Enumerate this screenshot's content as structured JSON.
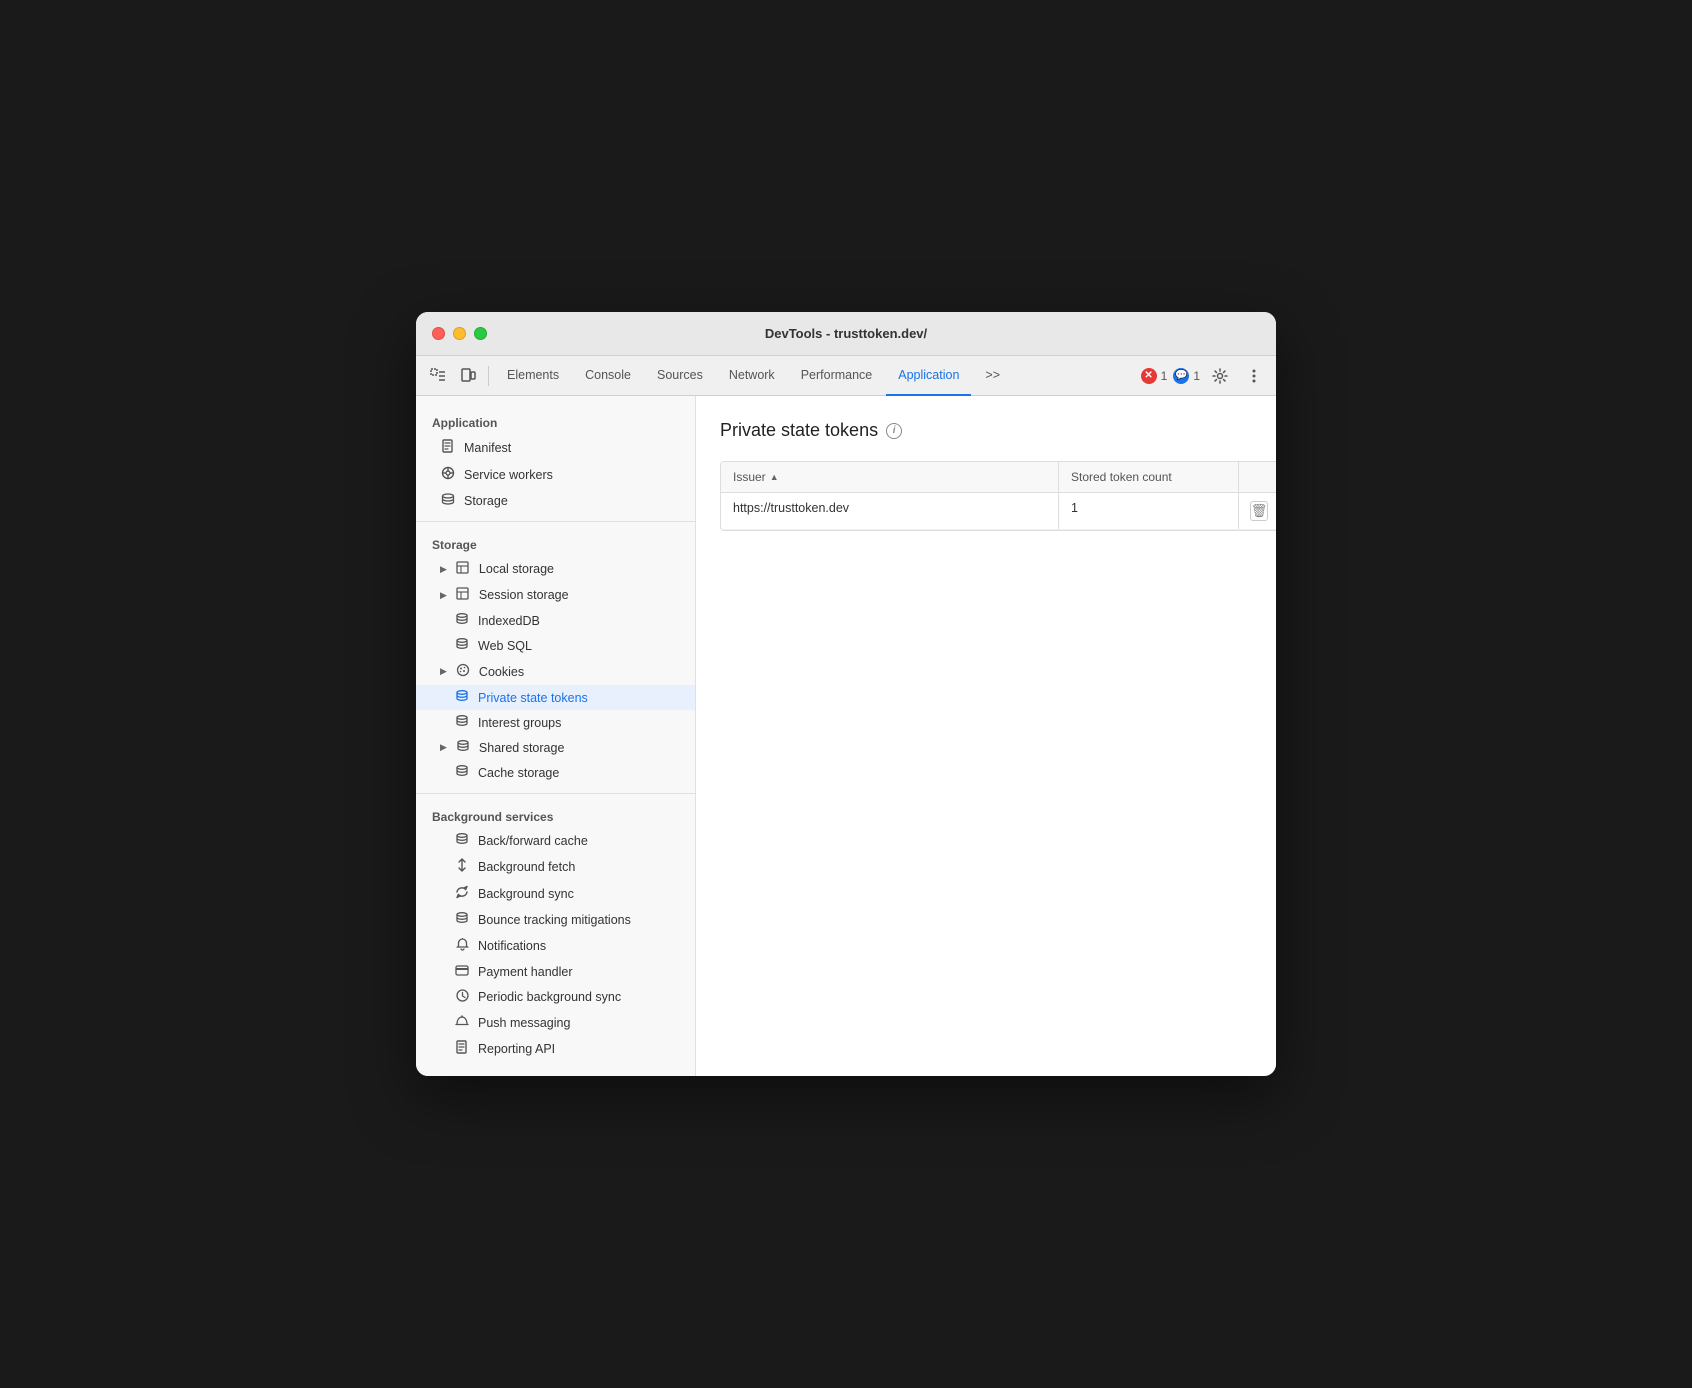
{
  "window": {
    "title": "DevTools - trusttoken.dev/"
  },
  "toolbar": {
    "tabs": [
      {
        "id": "elements",
        "label": "Elements",
        "active": false
      },
      {
        "id": "console",
        "label": "Console",
        "active": false
      },
      {
        "id": "sources",
        "label": "Sources",
        "active": false
      },
      {
        "id": "network",
        "label": "Network",
        "active": false
      },
      {
        "id": "performance",
        "label": "Performance",
        "active": false
      },
      {
        "id": "application",
        "label": "Application",
        "active": true
      }
    ],
    "more_label": ">>",
    "error_count": "1",
    "info_count": "1"
  },
  "sidebar": {
    "application_section": "Application",
    "application_items": [
      {
        "id": "manifest",
        "label": "Manifest",
        "icon": "📄",
        "has_arrow": false
      },
      {
        "id": "service-workers",
        "label": "Service workers",
        "icon": "⚙",
        "has_arrow": false
      },
      {
        "id": "storage",
        "label": "Storage",
        "icon": "🗄",
        "has_arrow": false
      }
    ],
    "storage_section": "Storage",
    "storage_items": [
      {
        "id": "local-storage",
        "label": "Local storage",
        "icon": "⊞",
        "has_arrow": true
      },
      {
        "id": "session-storage",
        "label": "Session storage",
        "icon": "⊞",
        "has_arrow": true
      },
      {
        "id": "indexeddb",
        "label": "IndexedDB",
        "icon": "🗄",
        "has_arrow": false
      },
      {
        "id": "web-sql",
        "label": "Web SQL",
        "icon": "🗄",
        "has_arrow": false
      },
      {
        "id": "cookies",
        "label": "Cookies",
        "icon": "🍪",
        "has_arrow": true
      },
      {
        "id": "private-state-tokens",
        "label": "Private state tokens",
        "icon": "🗄",
        "has_arrow": false,
        "active": true
      },
      {
        "id": "interest-groups",
        "label": "Interest groups",
        "icon": "🗄",
        "has_arrow": false
      },
      {
        "id": "shared-storage",
        "label": "Shared storage",
        "icon": "🗄",
        "has_arrow": true
      },
      {
        "id": "cache-storage",
        "label": "Cache storage",
        "icon": "🗄",
        "has_arrow": false
      }
    ],
    "background_section": "Background services",
    "background_items": [
      {
        "id": "back-forward-cache",
        "label": "Back/forward cache",
        "icon": "🗄",
        "has_arrow": false
      },
      {
        "id": "background-fetch",
        "label": "Background fetch",
        "icon": "↕",
        "has_arrow": false
      },
      {
        "id": "background-sync",
        "label": "Background sync",
        "icon": "↻",
        "has_arrow": false
      },
      {
        "id": "bounce-tracking",
        "label": "Bounce tracking mitigations",
        "icon": "🗄",
        "has_arrow": false
      },
      {
        "id": "notifications",
        "label": "Notifications",
        "icon": "🔔",
        "has_arrow": false
      },
      {
        "id": "payment-handler",
        "label": "Payment handler",
        "icon": "💳",
        "has_arrow": false
      },
      {
        "id": "periodic-background-sync",
        "label": "Periodic background sync",
        "icon": "🕐",
        "has_arrow": false
      },
      {
        "id": "push-messaging",
        "label": "Push messaging",
        "icon": "☁",
        "has_arrow": false
      },
      {
        "id": "reporting-api",
        "label": "Reporting API",
        "icon": "📄",
        "has_arrow": false
      }
    ]
  },
  "main": {
    "page_title": "Private state tokens",
    "table": {
      "columns": [
        {
          "id": "issuer",
          "label": "Issuer",
          "sortable": true
        },
        {
          "id": "token-count",
          "label": "Stored token count",
          "sortable": false
        },
        {
          "id": "actions",
          "label": "",
          "sortable": false
        }
      ],
      "rows": [
        {
          "issuer": "https://trusttoken.dev",
          "token_count": "1"
        }
      ]
    }
  }
}
